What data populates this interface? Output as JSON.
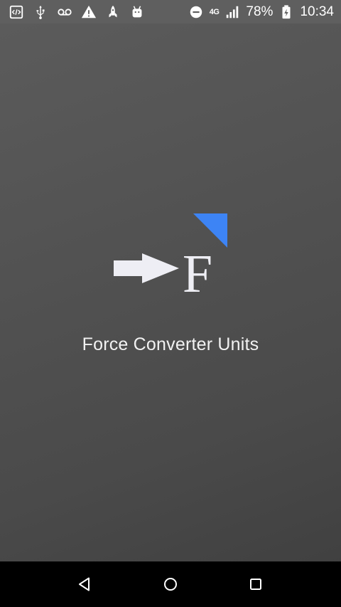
{
  "status_bar": {
    "left_icons": [
      "code-icon",
      "usb-icon",
      "voicemail-icon",
      "warning-icon",
      "rocket-icon",
      "android-icon"
    ],
    "network_label": "4G",
    "battery_percent": "78%",
    "time": "10:34"
  },
  "splash": {
    "title": "Force Converter Units",
    "logo_letter": "F",
    "accent_color": "#3d84f5"
  },
  "nav_bar": {
    "buttons": [
      "back-icon",
      "home-icon",
      "recents-icon"
    ]
  }
}
